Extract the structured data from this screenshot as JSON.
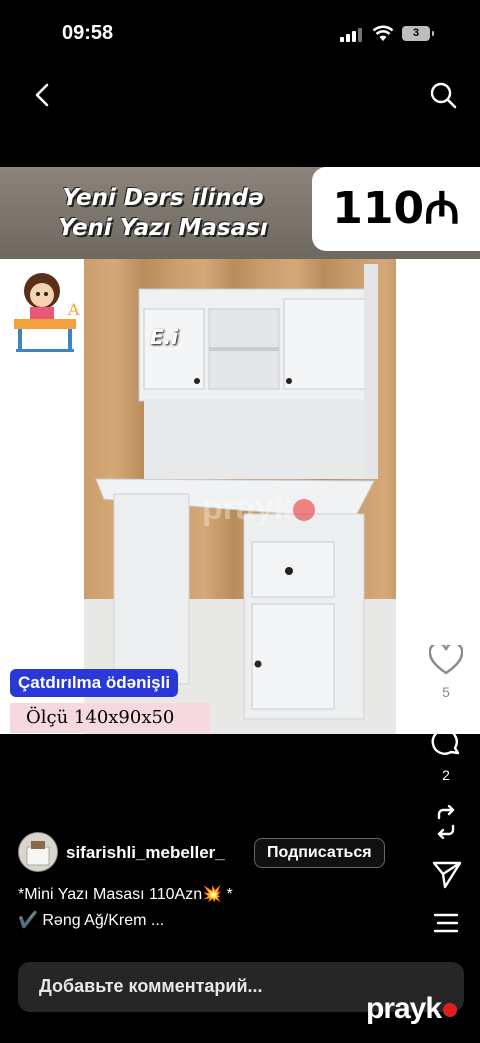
{
  "status_bar": {
    "time": "09:58",
    "battery": "3"
  },
  "nav": {
    "back_icon": "chevron-left-icon",
    "search_icon": "search-icon"
  },
  "post": {
    "banner_line1": "Yeni Dərs ilində",
    "banner_line2": "Yeni Yazı Masası",
    "price": "110₼",
    "brand_mark": "E.i",
    "delivery_label": "Çatdırılma ödənişli",
    "size_label": "Ölçü 140x90x50",
    "photo_watermark": "prayk"
  },
  "actions": {
    "likes": "5",
    "comments": "2"
  },
  "author": {
    "username": "sifarishli_mebeller_",
    "subscribe_label": "Подписаться"
  },
  "caption": {
    "line1": "*Mini Yazı Masası 110Azn💥 *",
    "line2": "✔️ Rəng Ağ/Krem ..."
  },
  "comment_box": {
    "placeholder": "Добавьте комментарий..."
  },
  "watermark": {
    "text": "prayk"
  },
  "colors": {
    "accent_blue": "#2a38d8",
    "size_bg": "#f5d9df",
    "brand_red": "#e02020"
  }
}
